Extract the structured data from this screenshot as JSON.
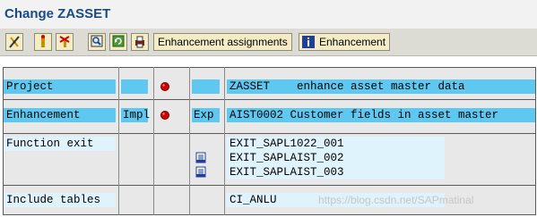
{
  "window": {
    "title": "Change ZASSET"
  },
  "toolbar": {
    "enh_assign_label": "Enhancement assignments",
    "enhancement_label": "Enhancement",
    "icons": [
      "display-change-icon",
      "activate-icon",
      "deactivate-icon",
      "find-icon",
      "refresh-icon",
      "print-icon",
      "info-icon"
    ]
  },
  "rows": {
    "project": {
      "label": "Project",
      "value": "ZASSET    enhance asset master data"
    },
    "enhancement": {
      "label": "Enhancement",
      "impl": "Impl",
      "exp": "Exp",
      "value": "AIST0002 Customer fields in asset master"
    },
    "function_exit": {
      "label": "Function exit",
      "items": [
        "EXIT_SAPL1022_001",
        "EXIT_SAPLAIST_002",
        "EXIT_SAPLAIST_003"
      ]
    },
    "include_tables": {
      "label": "Include tables",
      "value": "CI_ANLU"
    }
  },
  "colors": {
    "accent": "#5fc8f0",
    "led_red": "#d20000",
    "title": "#1a4b86"
  },
  "watermark": "https://blog.csdn.net/SAPmatinal"
}
